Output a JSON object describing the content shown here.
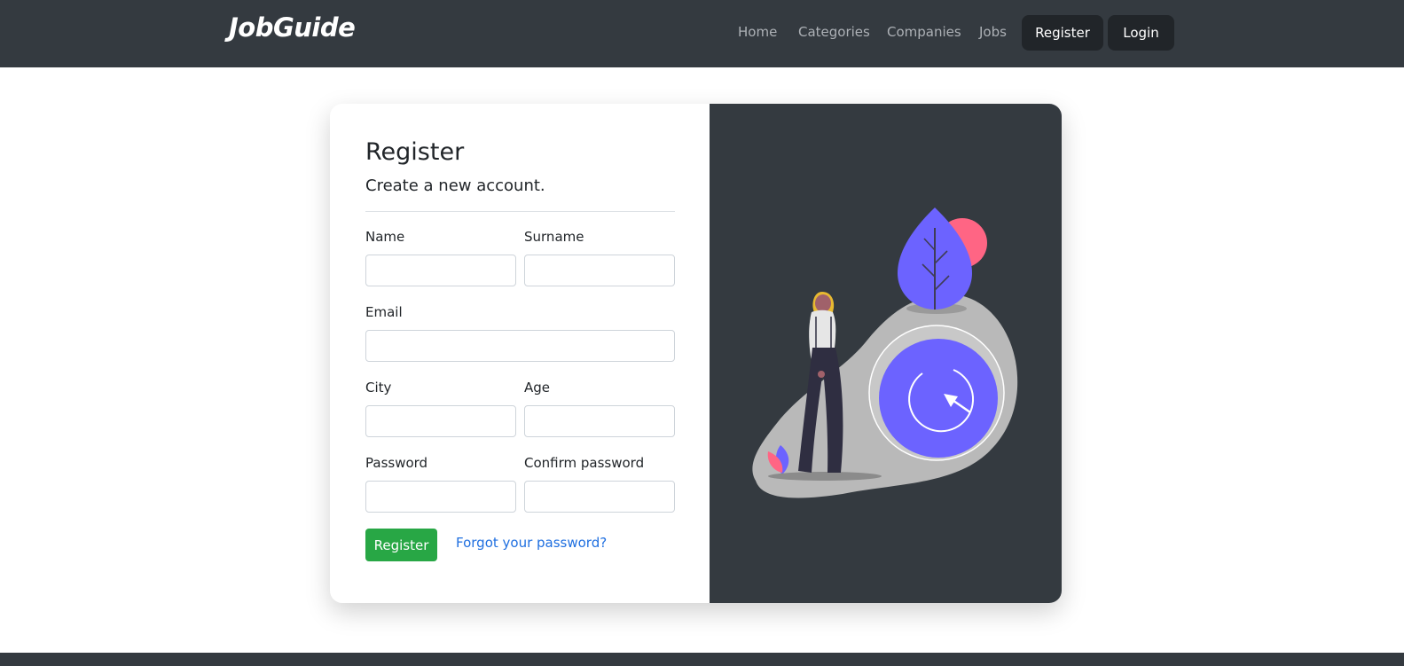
{
  "nav": {
    "brand": "JobGuide",
    "links": [
      "Home",
      "Categories",
      "Companies",
      "Jobs"
    ],
    "register_button": "Register",
    "login_button": "Login"
  },
  "form": {
    "title": "Register",
    "subtitle": "Create a new account.",
    "fields": {
      "name": {
        "label": "Name",
        "value": ""
      },
      "surname": {
        "label": "Surname",
        "value": ""
      },
      "email": {
        "label": "Email",
        "value": ""
      },
      "city": {
        "label": "City",
        "value": ""
      },
      "age": {
        "label": "Age",
        "value": ""
      },
      "password": {
        "label": "Password",
        "value": ""
      },
      "confirm_password": {
        "label": "Confirm password",
        "value": ""
      }
    },
    "submit_label": "Register",
    "forgot_link": "Forgot your password?"
  },
  "colors": {
    "navbar": "#343a40",
    "accent_green": "#28a745",
    "link_blue": "#1f6fe0",
    "illustration_purple": "#6c63ff",
    "illustration_pink": "#ff6584"
  }
}
